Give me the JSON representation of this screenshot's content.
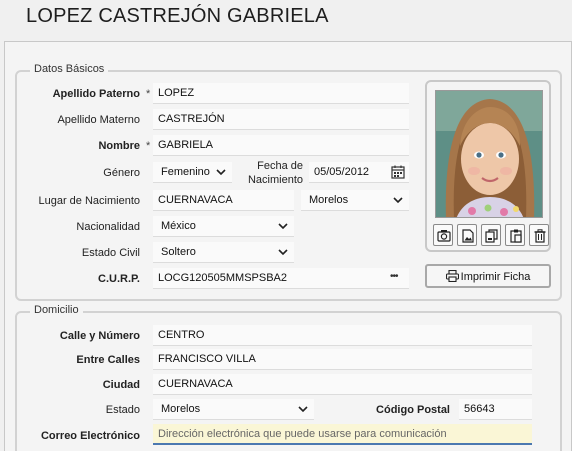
{
  "header": {
    "title": "LOPEZ CASTREJÓN GABRIELA"
  },
  "basic": {
    "legend": "Datos Básicos",
    "apellido_paterno": {
      "label": "Apellido Paterno",
      "req": "*",
      "value": "LOPEZ"
    },
    "apellido_materno": {
      "label": "Apellido Materno",
      "value": "CASTREJÓN"
    },
    "nombre": {
      "label": "Nombre",
      "req": "*",
      "value": "GABRIELA"
    },
    "genero": {
      "label": "Género",
      "value": "Femenino"
    },
    "fecha_nacimiento": {
      "label_line1": "Fecha de",
      "label_line2": "Nacimiento",
      "value": "05/05/2012"
    },
    "lugar_nacimiento": {
      "label": "Lugar de Nacimiento",
      "value": "CUERNAVACA",
      "state": "Morelos"
    },
    "nacionalidad": {
      "label": "Nacionalidad",
      "value": "México"
    },
    "estado_civil": {
      "label": "Estado Civil",
      "value": "Soltero"
    },
    "curp": {
      "label": "C.U.R.P.",
      "value": "LOCG120505MMSPSBA2",
      "more": "•••"
    }
  },
  "photo": {
    "tools": [
      "camera-icon",
      "image-file-icon",
      "copy-icon",
      "paste-icon",
      "trash-icon"
    ],
    "print_label": "Imprimir Ficha"
  },
  "address": {
    "legend": "Domicilio",
    "calle": {
      "label": "Calle y Número",
      "value": "CENTRO"
    },
    "entre_calles": {
      "label": "Entre Calles",
      "value": "FRANCISCO VILLA"
    },
    "ciudad": {
      "label": "Ciudad",
      "value": "CUERNAVACA"
    },
    "estado": {
      "label": "Estado",
      "value": "Morelos"
    },
    "codigo_postal": {
      "label": "Código Postal",
      "value": "56643"
    },
    "correo": {
      "label": "Correo Electrónico",
      "placeholder": "Dirección electrónica que puede usarse para comunicación"
    }
  }
}
